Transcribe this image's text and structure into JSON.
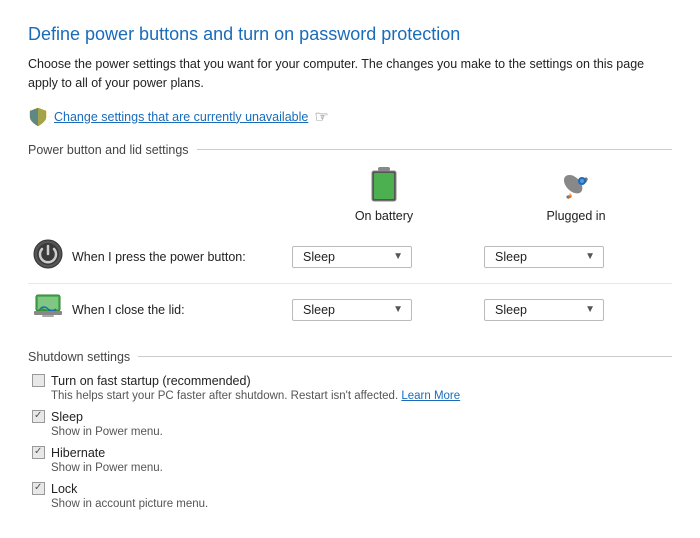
{
  "page": {
    "title": "Define power buttons and turn on password protection",
    "description": "Choose the power settings that you want for your computer. The changes you make to the settings on this page apply to all of your power plans.",
    "change_settings_link": "Change settings that are currently unavailable"
  },
  "power_button_section": {
    "header": "Power button and lid settings",
    "columns": {
      "on_battery": "On battery",
      "plugged_in": "Plugged in"
    },
    "rows": [
      {
        "label": "When I press the power button:",
        "on_battery_value": "Sleep",
        "plugged_in_value": "Sleep"
      },
      {
        "label": "When I close the lid:",
        "on_battery_value": "Sleep",
        "plugged_in_value": "Sleep"
      }
    ]
  },
  "shutdown_section": {
    "header": "Shutdown settings",
    "items": [
      {
        "label": "Turn on fast startup (recommended)",
        "description": "This helps start your PC faster after shutdown. Restart isn't affected.",
        "learn_more": "Learn More",
        "checked": false
      },
      {
        "label": "Sleep",
        "description": "Show in Power menu.",
        "learn_more": "",
        "checked": true
      },
      {
        "label": "Hibernate",
        "description": "Show in Power menu.",
        "learn_more": "",
        "checked": true
      },
      {
        "label": "Lock",
        "description": "Show in account picture menu.",
        "learn_more": "",
        "checked": true
      }
    ]
  },
  "icons": {
    "battery": "🔋",
    "pluggedin": "🚀",
    "power_button": "⏻",
    "lid": "💻",
    "shield": "🛡️"
  }
}
